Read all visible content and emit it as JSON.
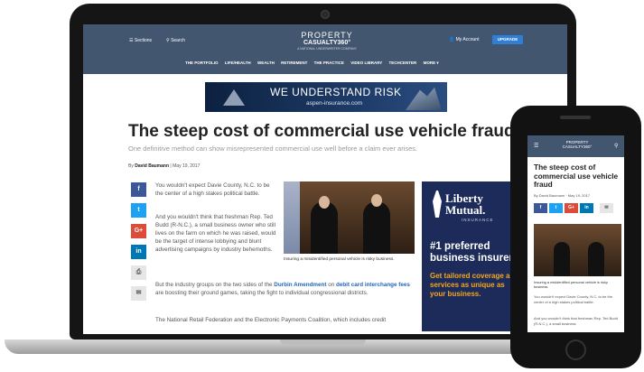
{
  "site": {
    "logo_line1": "PROPERTY",
    "logo_line2": "CASUALTY360°",
    "logo_line3": "A NATIONAL UNDERWRITER COMPANY",
    "sections_label": "Sections",
    "search_label": "Search",
    "account_label": "My Account",
    "upgrade_label": "UPGRADE",
    "nav": [
      "THE PORTFOLIO",
      "LIFE/HEALTH",
      "WEALTH",
      "RETIREMENT",
      "THE PRACTICE",
      "VIDEO LIBRARY",
      "TECHCENTER",
      "MORE ▾"
    ]
  },
  "ad": {
    "headline": "WE UNDERSTAND RISK",
    "url": "aspen-insurance.com"
  },
  "article": {
    "title": "The steep cost of commercial use vehicle fraud",
    "subtitle": "One definitive method can show misrepresented commercial use well before a claim ever arises.",
    "byline_prefix": "By",
    "author": "David Baumann",
    "date": "May 19, 2017",
    "para1": "You wouldn't expect Davie County, N.C. to be the center of a high stakes political battle.",
    "para2": "And you wouldn't think that freshman Rep. Ted Budd (R-N.C.), a small business owner who still lives on the farm on which he was raised, would be the target of intense lobbying and blunt advertising campaigns by industry behemoths.",
    "para3_a": "But the industry groups on the two sides of the",
    "para3_link1": "Durbin Amendment",
    "para3_b": "on",
    "para3_link2": "debit card interchange fees",
    "para3_c": "are boosting their ground games, taking the fight to individual congressional districts.",
    "para4": "The National Retail Federation and the Electronic Payments Coalition, which includes credit",
    "photo_caption": "Insuring a misidentified personal vehicle is risky business."
  },
  "side_ad": {
    "brand": "Liberty Mutual.",
    "brand_sub": "INSURANCE",
    "line1": "#1 preferred business insurer",
    "line2": "Get tailored coverage and services as unique as your business."
  },
  "social": {
    "facebook": "f",
    "twitter": "t",
    "google": "G+",
    "linkedin": "in",
    "print": "⎙",
    "email": "✉"
  },
  "phone": {
    "title": "The steep cost of commercial use vehicle fraud",
    "byline": "By David Baumann · May 19, 2017",
    "caption": "Insuring a misidentified personal vehicle is risky business.",
    "para1": "You wouldn't expect Davie County, N.C. to be the center of a high stakes political battle.",
    "para2": "And you wouldn't think that freshman Rep. Ted Budd (R-N.C.), a small business"
  }
}
